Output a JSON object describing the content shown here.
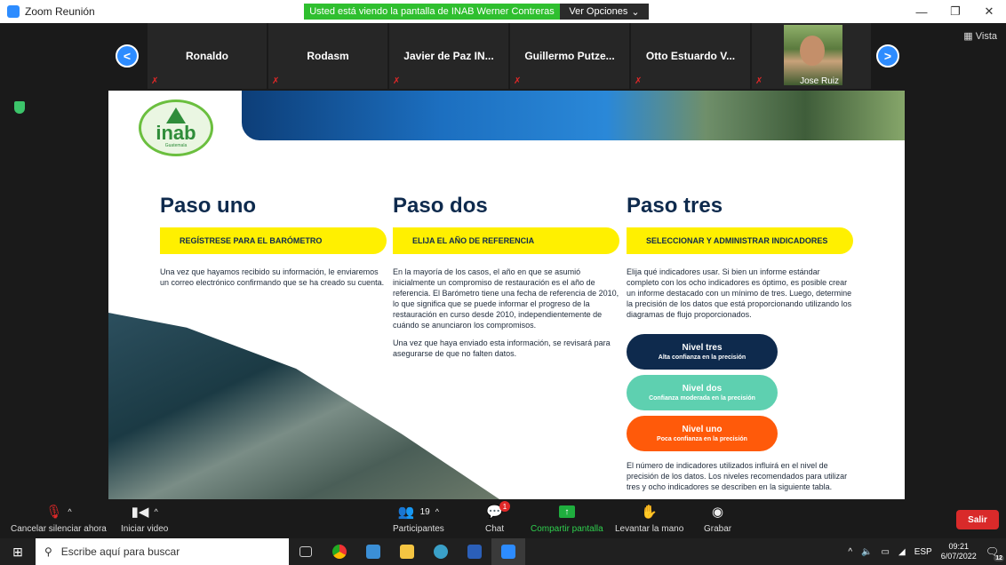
{
  "window": {
    "title": "Zoom Reunión",
    "share_banner": "Usted está viendo la pantalla de INAB Werner Contreras",
    "view_options": "Ver Opciones",
    "view_options_arrow": "⌄",
    "minimize": "—",
    "maximize": "❐",
    "close": "✕"
  },
  "strip": {
    "prev": "<",
    "next": ">",
    "participants": [
      "Ronaldo",
      "Rodasm",
      "Javier de Paz IN...",
      "Guillermo  Putze...",
      "Otto Estuardo V..."
    ],
    "video_participant": "Jose Ruiz",
    "view_label": "Vista"
  },
  "document": {
    "logo_text": "inab",
    "logo_sub": "Guatemala",
    "columns": [
      {
        "title": "Paso uno",
        "pill": "REGÍSTRESE PARA EL BARÓMETRO",
        "paragraphs": [
          "Una vez que hayamos recibido su información, le enviaremos un correo electrónico confirmando que se ha creado su cuenta."
        ]
      },
      {
        "title": "Paso dos",
        "pill": "ELIJA EL AÑO DE REFERENCIA",
        "paragraphs": [
          "En la mayoría de los casos, el año en que se asumió inicialmente un compromiso de restauración es el año de referencia. El Barómetro tiene una fecha de referencia de 2010, lo que significa que se puede informar el progreso de la restauración en curso desde 2010, independientemente de cuándo se anunciaron los compromisos.",
          "Una vez que haya enviado esta información, se revisará para asegurarse de que no falten datos."
        ]
      },
      {
        "title": "Paso tres",
        "pill": "SELECCIONAR Y ADMINISTRAR INDICADORES",
        "paragraphs": [
          "Elija qué indicadores usar. Si bien un informe estándar completo con los ocho indicadores es óptimo, es posible crear un informe destacado con un mínimo de tres. Luego, determine la precisión de los datos que está proporcionando utilizando los diagramas de flujo proporcionados."
        ],
        "levels": [
          {
            "title": "Nivel tres",
            "sub": "Alta confianza en la precisión",
            "color": "#0e2a4d"
          },
          {
            "title": "Nivel dos",
            "sub": "Confianza moderada en la precisión",
            "color": "#5ed0b0"
          },
          {
            "title": "Nivel uno",
            "sub": "Poca confianza en la precisión",
            "color": "#ff5a0a"
          }
        ],
        "footer": "El número de indicadores utilizados influirá en el nivel de precisión de los datos. Los niveles recomendados para utilizar tres y ocho indicadores se describen en la siguiente tabla."
      }
    ]
  },
  "toolbar": {
    "mute": "Cancelar silenciar ahora",
    "video": "Iniciar video",
    "participants": "Participantes",
    "participants_count": "19",
    "chat": "Chat",
    "chat_badge": "1",
    "share": "Compartir pantalla",
    "raise_hand": "Levantar la mano",
    "record": "Grabar",
    "leave": "Salir"
  },
  "taskbar": {
    "search_placeholder": "Escribe aquí para buscar",
    "language": "ESP",
    "time": "09:21",
    "date": "6/07/2022",
    "notifications": "12"
  }
}
